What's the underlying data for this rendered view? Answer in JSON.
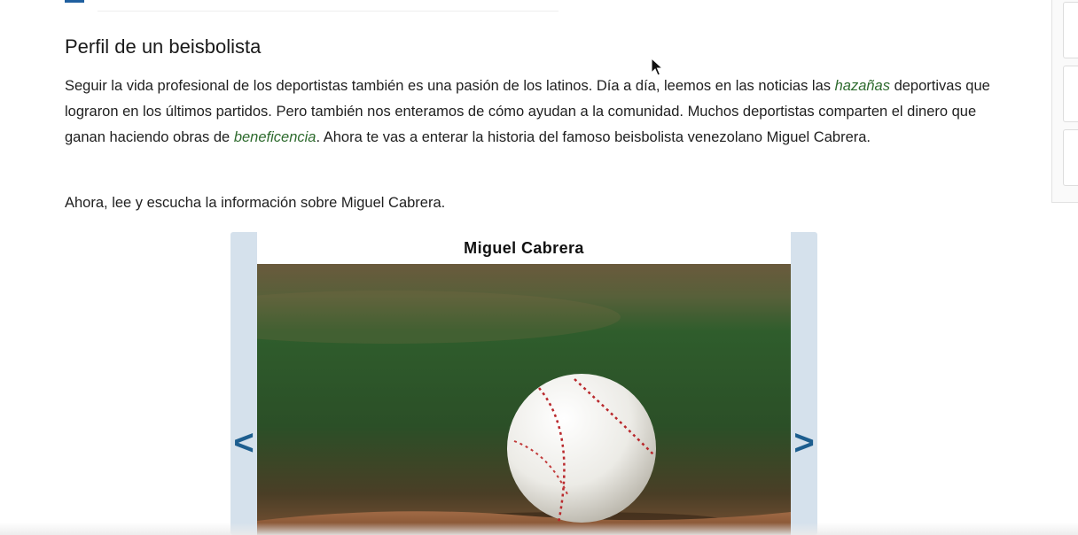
{
  "section": {
    "title": "Perfil de un beisbolista"
  },
  "intro": {
    "part1": "Seguir la vida profesional de los deportistas también es una pasión de los latinos. Día a día, leemos en las noticias las ",
    "term1": "hazañas",
    "part2": " deportivas que lograron en los últimos partidos. Pero también nos enteramos de cómo ayudan a la comunidad. Muchos deportistas comparten el dinero que ganan haciendo obras de ",
    "term2": "beneficencia",
    "part3": ". Ahora te vas a enterar la historia del famoso beisbolista venezolano Miguel Cabrera."
  },
  "instruction": "Ahora, lee y escucha la información sobre Miguel Cabrera.",
  "slideshow": {
    "title": "Miguel Cabrera",
    "prev_label": "<",
    "next_label": ">"
  },
  "colors": {
    "glossary_term": "#2e6b2e",
    "nav_arrow": "#1d5e8f",
    "slideshow_frame": "#d5e1ec"
  },
  "icons": {
    "pointer": "mouse-cursor-icon",
    "prev": "chevron-left-icon",
    "next": "chevron-right-icon"
  }
}
